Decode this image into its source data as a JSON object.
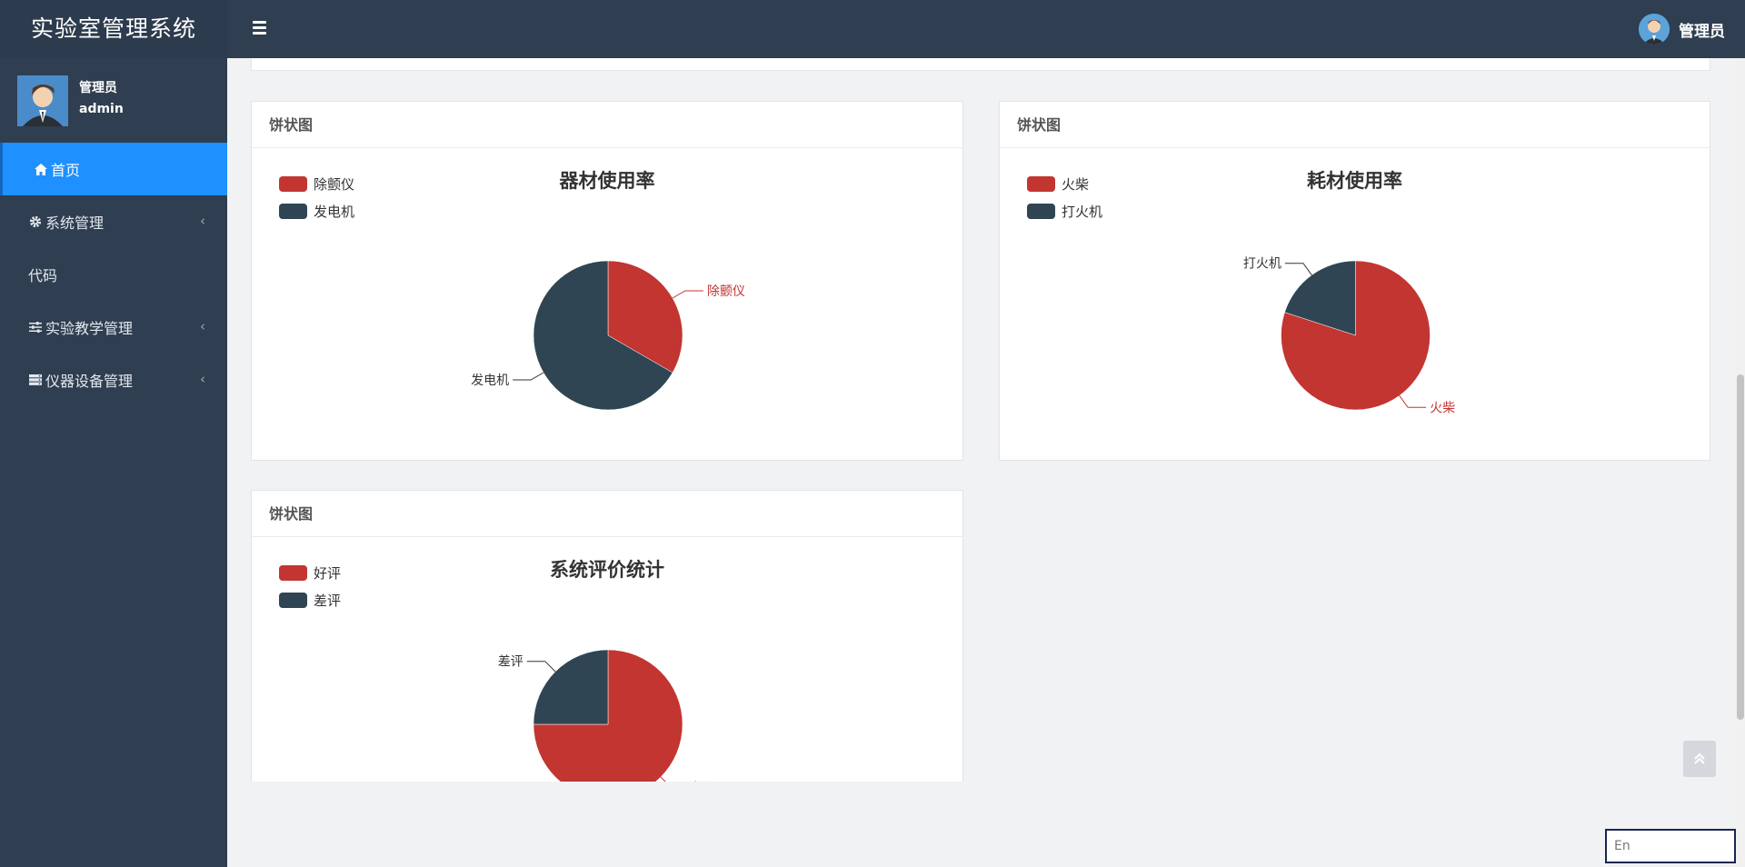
{
  "app": {
    "title": "实验室管理系统"
  },
  "header": {
    "user_label": "管理员"
  },
  "sidebar": {
    "user": {
      "name": "管理员",
      "role": "admin"
    },
    "items": [
      {
        "label": "首页",
        "icon": "home-icon",
        "active": true
      },
      {
        "label": "系统管理",
        "icon": "gear-icon",
        "has_children": true
      },
      {
        "label": "代码",
        "icon": "",
        "has_children": false
      },
      {
        "label": "实验教学管理",
        "icon": "sliders-icon",
        "has_children": true
      },
      {
        "label": "仪器设备管理",
        "icon": "server-icon",
        "has_children": true
      }
    ]
  },
  "colors": {
    "series_red": "#c23531",
    "series_navy": "#2f4554",
    "active_blue": "#1e90ff",
    "dark_bg": "#2f3e50"
  },
  "panels": [
    {
      "header": "饼状图"
    },
    {
      "header": "饼状图"
    },
    {
      "header": "饼状图"
    }
  ],
  "chart_data": [
    {
      "type": "pie",
      "title": "器材使用率",
      "legend": [
        "除颤仪",
        "发电机"
      ],
      "slices": [
        {
          "label": "除颤仪",
          "value": 1
        },
        {
          "label": "发电机",
          "value": 2
        }
      ]
    },
    {
      "type": "pie",
      "title": "耗材使用率",
      "legend": [
        "火柴",
        "打火机"
      ],
      "slices": [
        {
          "label": "火柴",
          "value": 4
        },
        {
          "label": "打火机",
          "value": 1
        }
      ]
    },
    {
      "type": "pie",
      "title": "系统评价统计",
      "legend": [
        "好评",
        "差评"
      ],
      "slices": [
        {
          "label": "好评",
          "value": 3
        },
        {
          "label": "差评",
          "value": 1
        }
      ]
    }
  ],
  "ime": {
    "text": "En"
  }
}
